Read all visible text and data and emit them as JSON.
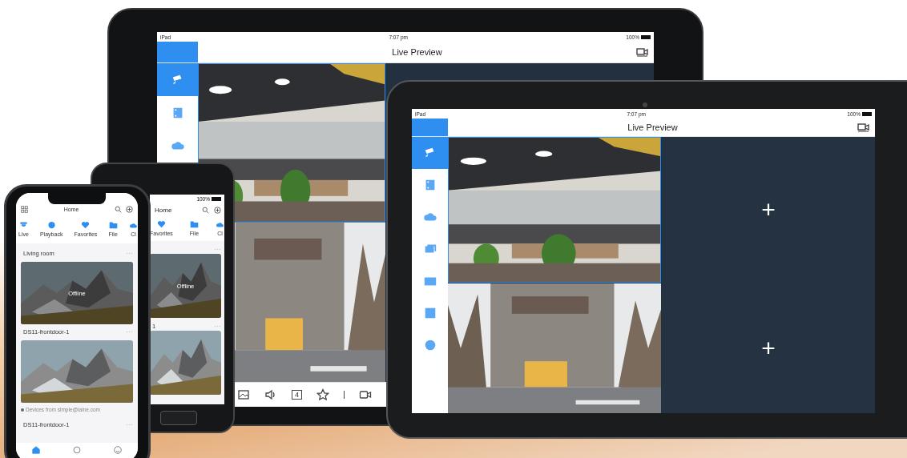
{
  "back_tablet": {
    "status_bar": {
      "carrier": "iPad",
      "time": "7:07 pm",
      "battery": "100%"
    },
    "title": "Live Preview",
    "sidebar": [
      {
        "selected": true
      },
      {
        "selected": false
      },
      {
        "selected": false
      }
    ],
    "tiles": [
      {
        "kind": "picture",
        "selected": true
      },
      {
        "kind": "picture",
        "selected": false
      }
    ],
    "toolbar": {
      "window_count": "4"
    }
  },
  "front_tablet": {
    "status_bar": {
      "carrier": "iPad",
      "time": "7:07 pm",
      "battery": "100%"
    },
    "title": "Live Preview",
    "sidebar": [
      {
        "selected": true
      },
      {
        "selected": false
      },
      {
        "selected": false
      },
      {
        "selected": false
      },
      {
        "selected": false
      },
      {
        "selected": false
      },
      {
        "selected": false
      }
    ],
    "tiles": [
      {
        "kind": "picture",
        "selected": true
      },
      {
        "kind": "add",
        "label": "+"
      },
      {
        "kind": "picture",
        "selected": false
      },
      {
        "kind": "add",
        "label": "+"
      }
    ]
  },
  "android_phone": {
    "battery": "100%",
    "title": "Home",
    "nav": [
      "Favorites",
      "File",
      "Cl"
    ],
    "cards": [
      {
        "status": "Offline"
      },
      {
        "name": "1"
      }
    ]
  },
  "iphone": {
    "title": "Home",
    "nav": [
      "Live",
      "Playback",
      "Favorites",
      "File",
      "Cl"
    ],
    "cards": [
      {
        "name": "Living room",
        "status": "Offline"
      },
      {
        "name": "DS11-frontdoor-1",
        "note": "Devices from simple@laine.com"
      },
      {
        "name": "DS11-frontdoor-1"
      }
    ],
    "tabs": [
      {
        "selected": true
      },
      {
        "selected": false
      },
      {
        "selected": false
      }
    ]
  }
}
